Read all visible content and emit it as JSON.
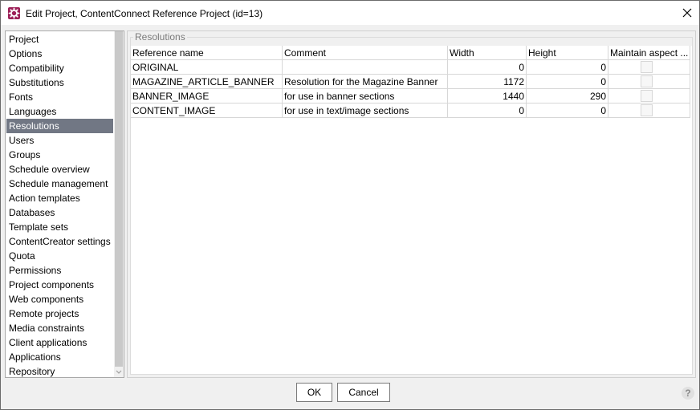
{
  "window": {
    "title": "Edit Project, ContentConnect Reference Project (id=13)",
    "close_label": "close"
  },
  "nav": {
    "selected_index": 6,
    "items": [
      "Project",
      "Options",
      "Compatibility",
      "Substitutions",
      "Fonts",
      "Languages",
      "Resolutions",
      "Users",
      "Groups",
      "Schedule overview",
      "Schedule management",
      "Action templates",
      "Databases",
      "Template sets",
      "ContentCreator settings",
      "Quota",
      "Permissions",
      "Project components",
      "Web components",
      "Remote projects",
      "Media constraints",
      "Client applications",
      "Applications",
      "Repository"
    ]
  },
  "resolutions": {
    "group_title": "Resolutions",
    "columns": [
      "Reference name",
      "Comment",
      "Width",
      "Height",
      "Maintain aspect ..."
    ],
    "rows": [
      {
        "name": "ORIGINAL",
        "comment": "",
        "width": "0",
        "height": "0",
        "maintain": false
      },
      {
        "name": "MAGAZINE_ARTICLE_BANNER",
        "comment": "Resolution for the Magazine Banner",
        "width": "1172",
        "height": "0",
        "maintain": false
      },
      {
        "name": "BANNER_IMAGE",
        "comment": "for use in banner sections",
        "width": "1440",
        "height": "290",
        "maintain": false
      },
      {
        "name": "CONTENT_IMAGE",
        "comment": "for use in text/image sections",
        "width": "0",
        "height": "0",
        "maintain": false
      }
    ]
  },
  "buttons": {
    "ok": "OK",
    "cancel": "Cancel",
    "help": "?"
  },
  "colors": {
    "accent": "#9c1f57",
    "selection": "#717784"
  }
}
